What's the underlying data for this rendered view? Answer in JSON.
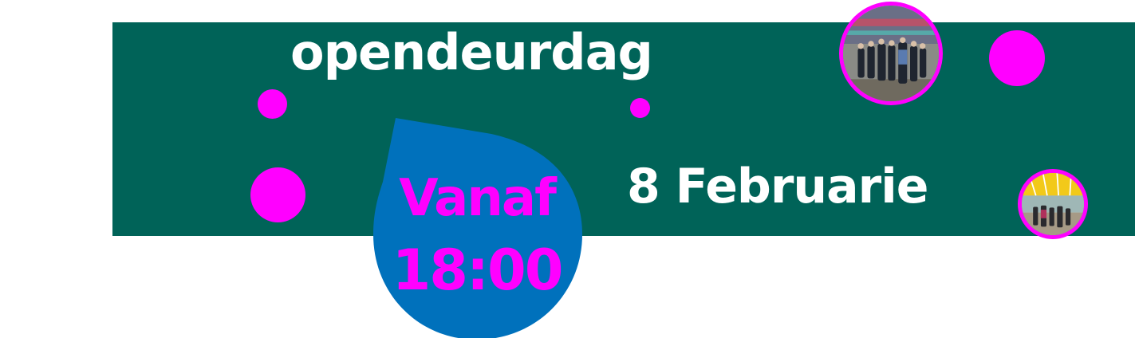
{
  "banner": {
    "headline": "opendeurdag",
    "date": "8 Februarie",
    "time_label": "Vanaf",
    "time_value": "18:00"
  },
  "colors": {
    "band": "#006358",
    "accent": "#ff00ff",
    "drop": "#0071bc",
    "text_on_band": "#ffffff",
    "background": "#ffffff"
  },
  "photos": [
    {
      "name": "photo-courtyard-group",
      "subject": "group of people standing in a school courtyard"
    },
    {
      "name": "photo-atrium-group",
      "subject": "people under a glass roof atrium"
    }
  ]
}
